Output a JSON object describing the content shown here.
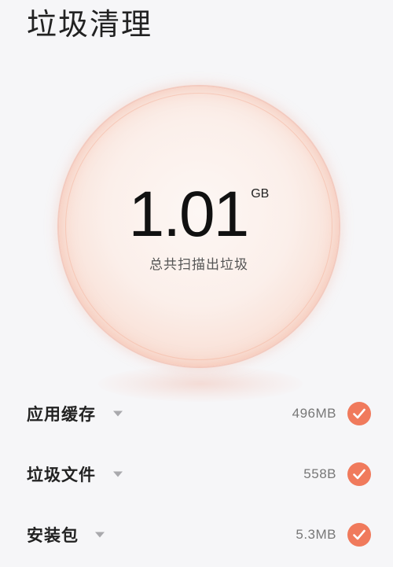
{
  "header": {
    "title": "垃圾清理"
  },
  "summary": {
    "value": "1.01",
    "unit": "GB",
    "caption": "总共扫描出垃圾"
  },
  "items": [
    {
      "label": "应用缓存",
      "size": "496MB",
      "checked": true,
      "icon": "chevron-down-icon"
    },
    {
      "label": "垃圾文件",
      "size": "558B",
      "checked": true,
      "icon": "chevron-down-icon"
    },
    {
      "label": "安装包",
      "size": "5.3MB",
      "checked": true,
      "icon": "chevron-down-icon"
    }
  ],
  "colors": {
    "accent": "#f07a5c",
    "orb_edge": "#f2a48b",
    "background": "#f6f6f8"
  }
}
